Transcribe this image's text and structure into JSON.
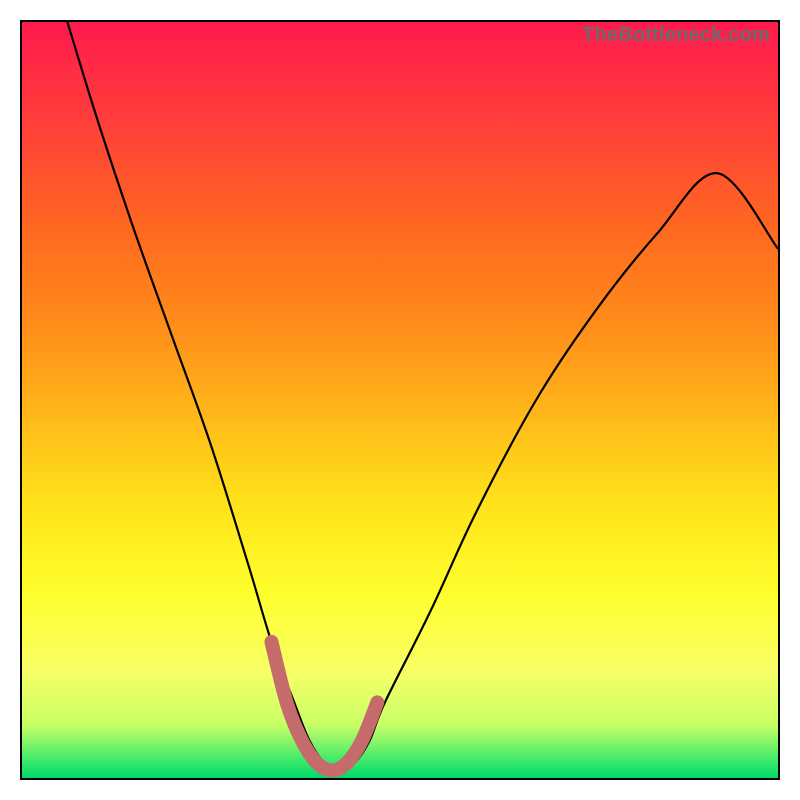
{
  "watermark": "TheBottleneck.com",
  "chart_data": {
    "type": "line",
    "title": "",
    "xlabel": "",
    "ylabel": "",
    "xlim": [
      0,
      100
    ],
    "ylim": [
      0,
      100
    ],
    "grid": false,
    "series": [
      {
        "name": "bottleneck-curve",
        "x": [
          6,
          10,
          15,
          20,
          25,
          30,
          33,
          36,
          38,
          40,
          42,
          44,
          46,
          48,
          54,
          60,
          68,
          76,
          84,
          92,
          100
        ],
        "y": [
          100,
          87,
          72,
          58,
          44,
          28,
          18,
          10,
          5,
          2,
          1,
          2,
          5,
          10,
          22,
          35,
          50,
          62,
          72,
          80,
          70
        ],
        "stroke": "#000000",
        "stroke_width": 2
      },
      {
        "name": "valley-highlight",
        "x": [
          33,
          35,
          37,
          39,
          41,
          43,
          45,
          47
        ],
        "y": [
          18,
          10,
          5,
          2,
          1,
          2,
          5,
          10
        ],
        "stroke": "#c56b6b",
        "stroke_width": 10,
        "linecap": "round"
      }
    ],
    "annotations": []
  }
}
